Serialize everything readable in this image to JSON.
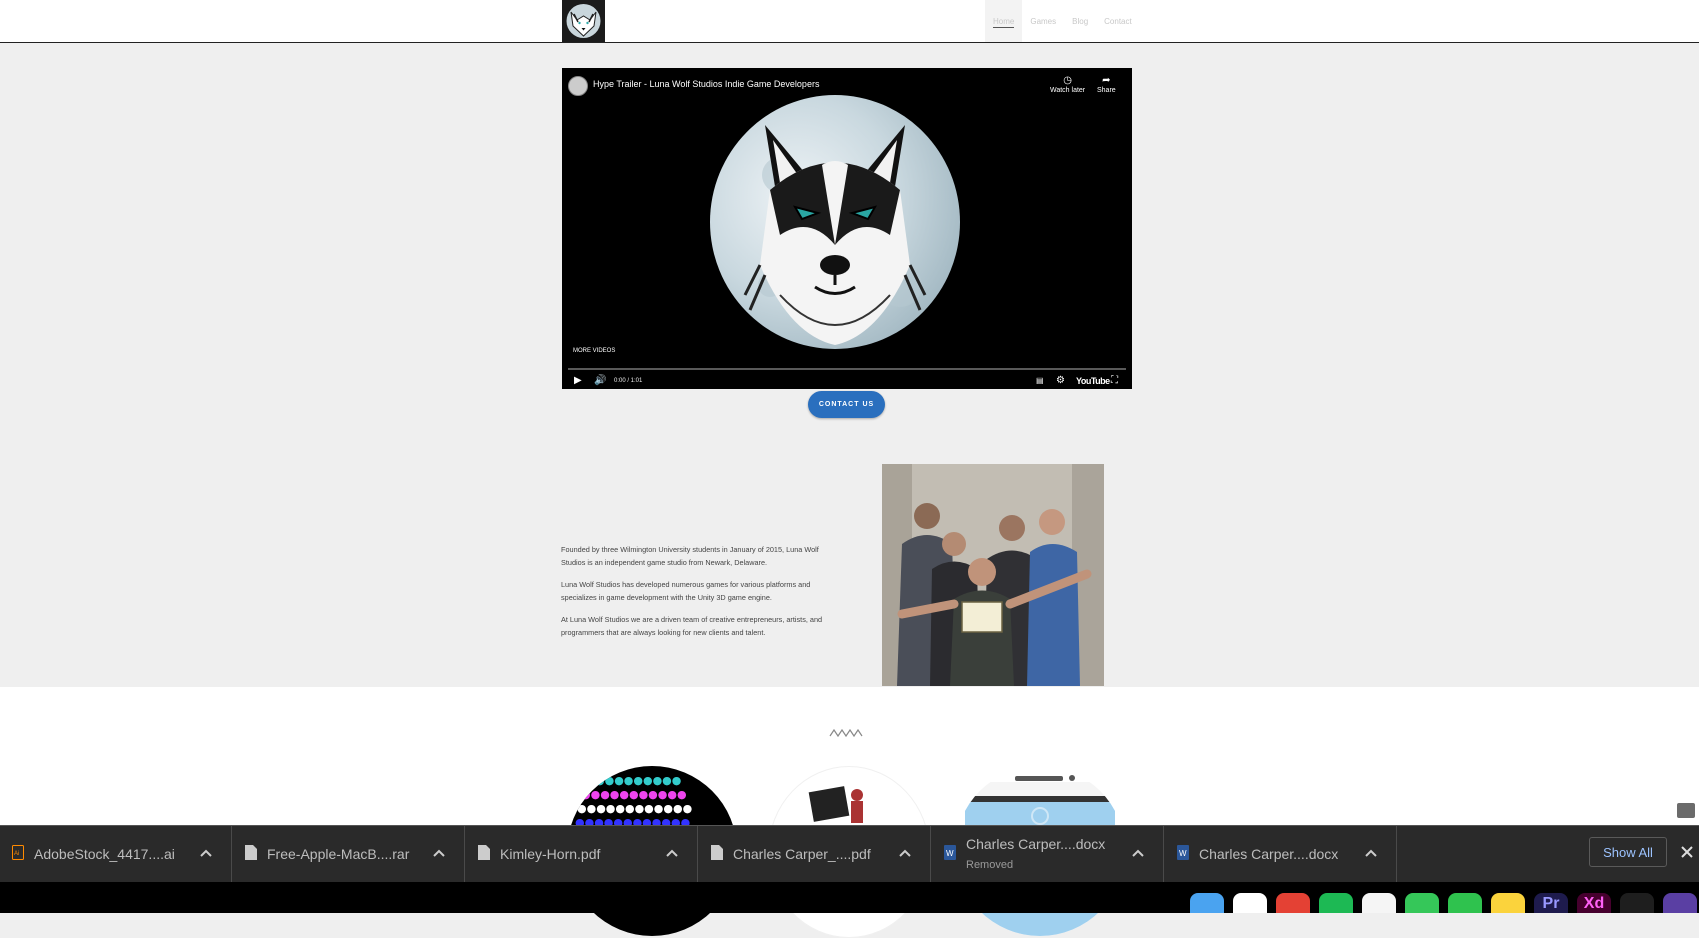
{
  "nav": {
    "items": [
      {
        "label": "Home",
        "active": true
      },
      {
        "label": "Games",
        "active": false
      },
      {
        "label": "Blog",
        "active": false
      },
      {
        "label": "Contact",
        "active": false
      }
    ]
  },
  "video": {
    "title": "Hype Trailer - Luna Wolf Studios Indie Game Developers",
    "watch_later": "Watch later",
    "share": "Share",
    "more_videos": "MORE VIDEOS",
    "time": "0:00 / 1:01",
    "youtube": "YouTube",
    "progress": 0
  },
  "contact_button": "CONTACT US",
  "about": {
    "paragraphs": [
      "Founded by three Wilmington University students in January of 2015, Luna Wolf Studios is an independent game studio from Newark, Delaware.",
      "Luna Wolf Studios has developed numerous games for various platforms and specializes in game development with the Unity 3D game engine.",
      "At Luna Wolf Studios we are a driven team of creative entrepreneurs, artists, and programmers that are always looking for new clients and talent."
    ]
  },
  "downloads": {
    "items": [
      {
        "name": "AdobeStock_4417....ai",
        "status": "",
        "icon": "adobe-illustrator-icon"
      },
      {
        "name": "Free-Apple-MacB....rar",
        "status": "",
        "icon": "file-icon"
      },
      {
        "name": "Kimley-Horn.pdf",
        "status": "",
        "icon": "file-icon"
      },
      {
        "name": "Charles Carper_....pdf",
        "status": "",
        "icon": "file-icon"
      },
      {
        "name": "Charles Carper....docx",
        "status": "Removed",
        "icon": "word-icon"
      },
      {
        "name": "Charles Carper....docx",
        "status": "",
        "icon": "word-icon"
      }
    ],
    "show_all": "Show All"
  },
  "dock": {
    "apps": [
      {
        "name": "finder-icon",
        "color": "#4aa3f0",
        "label": ""
      },
      {
        "name": "things-icon",
        "color": "#ffffff",
        "label": ""
      },
      {
        "name": "chrome-icon",
        "color": "#e44134",
        "label": ""
      },
      {
        "name": "spotify-icon",
        "color": "#1db954",
        "label": ""
      },
      {
        "name": "photos-icon",
        "color": "#f5f5f5",
        "label": ""
      },
      {
        "name": "messages-icon",
        "color": "#35c759",
        "label": ""
      },
      {
        "name": "facetime-icon",
        "color": "#2fc24e",
        "label": ""
      },
      {
        "name": "notes-icon",
        "color": "#fbd33c",
        "label": ""
      },
      {
        "name": "premiere-icon",
        "color": "#1e1b4d",
        "label": "Pr"
      },
      {
        "name": "xd-icon",
        "color": "#46002e",
        "label": "Xd"
      },
      {
        "name": "figma-icon",
        "color": "#1e1e1e",
        "label": ""
      },
      {
        "name": "app-icon",
        "color": "#5a3fa3",
        "label": ""
      }
    ]
  },
  "colors": {
    "accent": "#2a6fbe",
    "page_bg": "#efefef",
    "download_bar": "#2a2a2a"
  }
}
